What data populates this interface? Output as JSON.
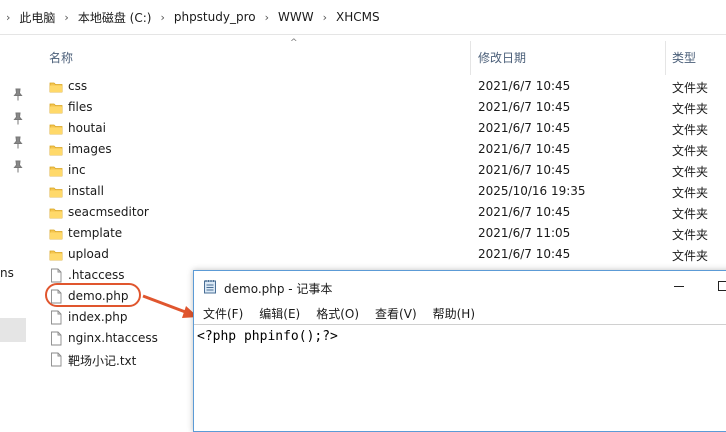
{
  "breadcrumb": [
    "此电脑",
    "本地磁盘 (C:)",
    "phpstudy_pro",
    "WWW",
    "XHCMS"
  ],
  "columns": {
    "name": "名称",
    "date": "修改日期",
    "type": "类型"
  },
  "nav_text": "ns",
  "files": [
    {
      "name": "css",
      "date": "2021/6/7 10:45",
      "type": "文件夹",
      "icon": "folder-icon"
    },
    {
      "name": "files",
      "date": "2021/6/7 10:45",
      "type": "文件夹",
      "icon": "folder-icon"
    },
    {
      "name": "houtai",
      "date": "2021/6/7 10:45",
      "type": "文件夹",
      "icon": "folder-icon"
    },
    {
      "name": "images",
      "date": "2021/6/7 10:45",
      "type": "文件夹",
      "icon": "folder-icon"
    },
    {
      "name": "inc",
      "date": "2021/6/7 10:45",
      "type": "文件夹",
      "icon": "folder-icon"
    },
    {
      "name": "install",
      "date": "2025/10/16 19:35",
      "type": "文件夹",
      "icon": "folder-icon"
    },
    {
      "name": "seacmseditor",
      "date": "2021/6/7 10:45",
      "type": "文件夹",
      "icon": "folder-icon"
    },
    {
      "name": "template",
      "date": "2021/6/7 11:05",
      "type": "文件夹",
      "icon": "folder-icon"
    },
    {
      "name": "upload",
      "date": "2021/6/7 10:45",
      "type": "文件夹",
      "icon": "folder-icon"
    },
    {
      "name": ".htaccess",
      "date": "",
      "type": "",
      "icon": "file-icon"
    },
    {
      "name": "demo.php",
      "date": "",
      "type": "",
      "icon": "file-icon"
    },
    {
      "name": "index.php",
      "date": "",
      "type": "",
      "icon": "file-icon"
    },
    {
      "name": "nginx.htaccess",
      "date": "",
      "type": "",
      "icon": "file-icon"
    },
    {
      "name": "靶场小记.txt",
      "date": "",
      "type": "",
      "icon": "file-icon"
    }
  ],
  "notepad": {
    "title": "demo.php - 记事本",
    "menu": [
      "文件(F)",
      "编辑(E)",
      "格式(O)",
      "查看(V)",
      "帮助(H)"
    ],
    "content": "<?php phpinfo();?>"
  },
  "colors": {
    "folder": "#f4c550",
    "highlight": "#e0562e",
    "column_header": "#4c607a"
  }
}
